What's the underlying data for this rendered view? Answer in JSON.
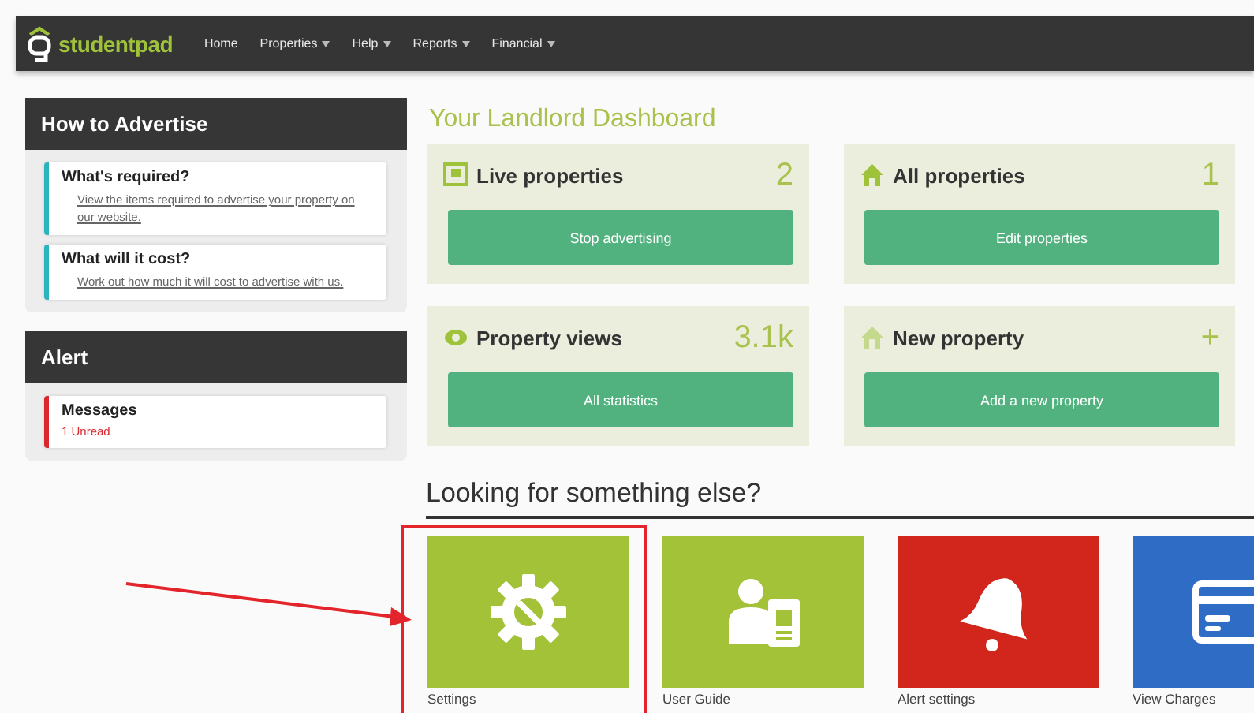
{
  "nav": {
    "logo": "studentpad",
    "items": [
      {
        "label": "Home",
        "dropdown": false
      },
      {
        "label": "Properties",
        "dropdown": true
      },
      {
        "label": "Help",
        "dropdown": true
      },
      {
        "label": "Reports",
        "dropdown": true
      },
      {
        "label": "Financial",
        "dropdown": true
      }
    ]
  },
  "panels": [
    {
      "title": "How to Advertise",
      "cards": [
        {
          "title": "What's required?",
          "text": "View the items required to advertise your property on our website.",
          "color": "#2bb3c0",
          "kind": "link"
        },
        {
          "title": "What will it cost?",
          "text": "Work out how much it will cost to advertise with us.",
          "color": "#2bb3c0",
          "kind": "link"
        }
      ]
    },
    {
      "title": "Alert",
      "cards": [
        {
          "title": "Messages",
          "text": "1 Unread",
          "color": "#d9272e",
          "kind": "alert"
        }
      ]
    }
  ],
  "dashboard": {
    "title": "Your Landlord Dashboard",
    "cards": [
      {
        "title": "Live properties",
        "count": "2",
        "button": "Stop advertising",
        "kind": "frame"
      },
      {
        "title": "All properties",
        "count": "1",
        "button": "Edit properties",
        "kind": "house"
      },
      {
        "title": "Property views",
        "count": "3.1k",
        "button": "All statistics",
        "kind": "eye"
      },
      {
        "title": "New property",
        "count": "+",
        "button": "Add a new property",
        "kind": "newhouse"
      }
    ]
  },
  "more": {
    "title": "Looking for something else?",
    "tiles": [
      {
        "label": "Settings",
        "color": "#a3c238",
        "kind": "gear",
        "highlighted": true
      },
      {
        "label": "User Guide",
        "color": "#a3c238",
        "kind": "guide",
        "highlighted": false
      },
      {
        "label": "Alert settings",
        "color": "#d2261c",
        "kind": "bell",
        "highlighted": false
      },
      {
        "label": "View Charges",
        "color": "#2f6cc6",
        "kind": "card",
        "highlighted": false
      }
    ]
  }
}
